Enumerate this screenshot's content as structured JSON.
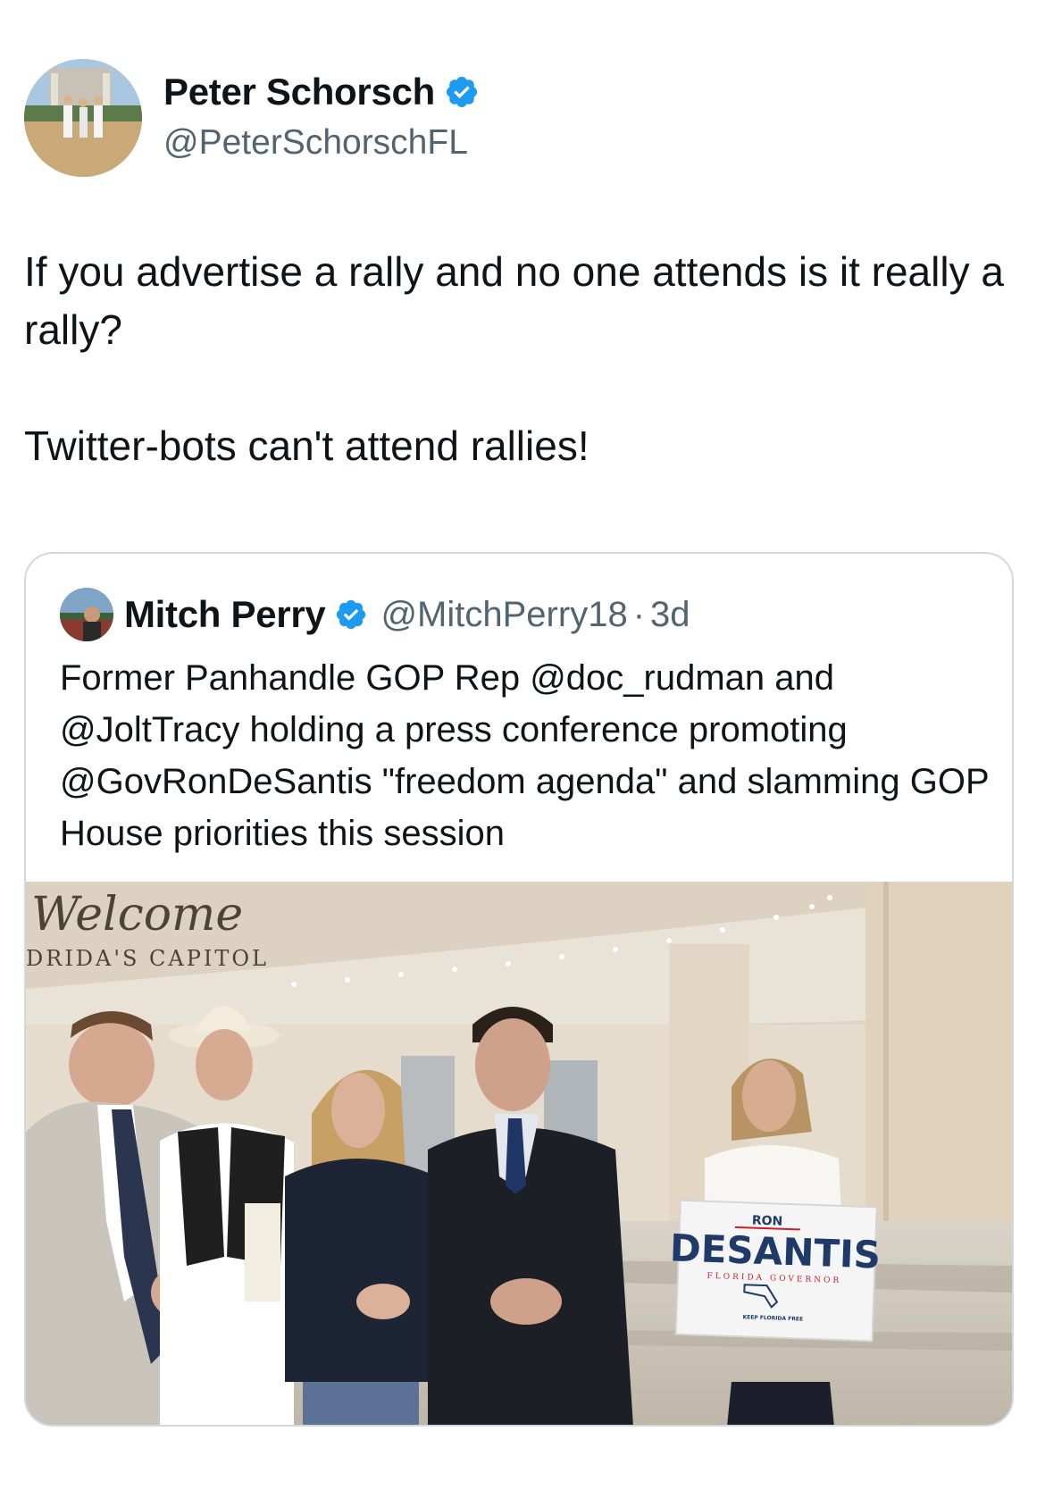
{
  "author": {
    "name": "Peter Schorsch",
    "handle": "@PeterSchorschFL",
    "verified_icon": "verified-badge-icon"
  },
  "tweet": {
    "lines": [
      "If you advertise a rally and no one attends is it really a rally?",
      "Twitter-bots can't attend rallies!"
    ]
  },
  "quote": {
    "name": "Mitch Perry",
    "handle": "@MitchPerry18",
    "separator": "·",
    "time": "3d",
    "text": "Former Panhandle GOP Rep @doc_rudman and @JoltTracy holding a press conference promoting @GovRonDeSantis \"freedom agenda\" and slamming GOP House priorities this session",
    "photo": {
      "wall_script": "Welcome",
      "wall_caption": "DRIDA'S CAPITOL",
      "sign": {
        "top": "RON",
        "main": "DESANTIS",
        "sub": "FLORIDA GOVERNOR",
        "footer": "KEEP FLORIDA FREE"
      }
    }
  },
  "colors": {
    "verified": "#1d9bf0",
    "secondary_text": "#536471",
    "border": "#cfd9de",
    "sign_blue": "#1f3a68",
    "sign_red": "#c8202f"
  }
}
